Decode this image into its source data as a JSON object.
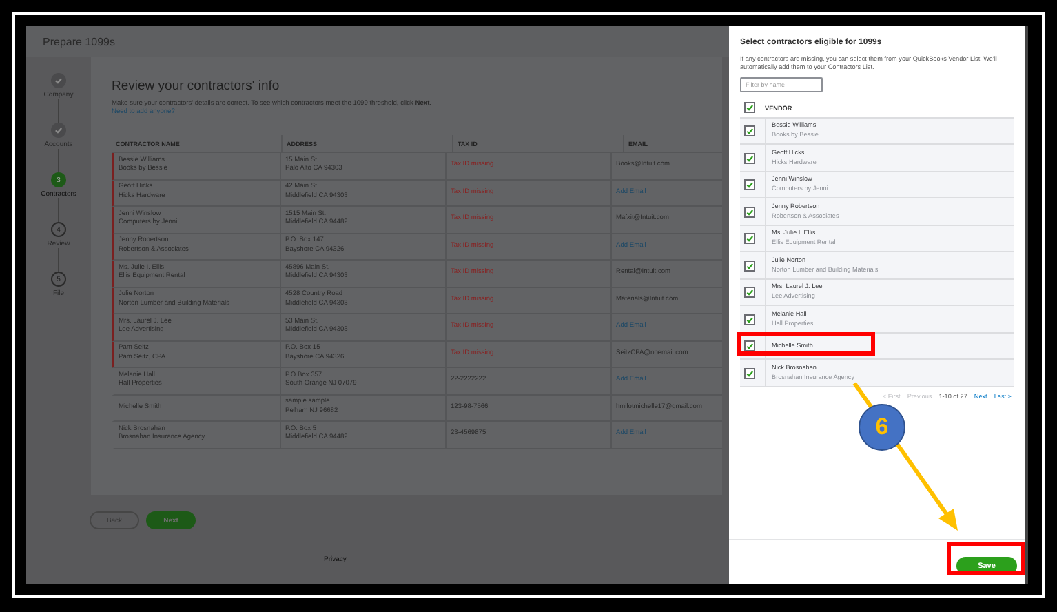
{
  "page": {
    "title": "Prepare 1099s",
    "steps": [
      {
        "label": "Company",
        "done": true,
        "selected": false
      },
      {
        "label": "Accounts",
        "done": true,
        "selected": false
      },
      {
        "label": "Contractors",
        "number": "3",
        "done": false,
        "selected": true
      },
      {
        "label": "Review",
        "number": "4",
        "done": false,
        "selected": false
      },
      {
        "label": "File",
        "number": "5",
        "done": false,
        "selected": false
      }
    ],
    "heading": "Review your contractors' info",
    "description": "Make sure your contractors' details are correct. To see which contractors meet the 1099 threshold, click **Next**.",
    "add_link": "Need to add anyone?",
    "table": {
      "columns": [
        "CONTRACTOR NAME",
        "ADDRESS",
        "TAX ID",
        "EMAIL"
      ],
      "rows": [
        {
          "name": "Bessie Williams",
          "company": "Books by Bessie",
          "address_1": "15 Main St.",
          "address_2": "Palo Alto CA 94303",
          "tax_id": "Tax ID missing",
          "tax_id_missing": true,
          "email": "Books@Intuit.com",
          "email_is_link": false
        },
        {
          "name": "Geoff Hicks",
          "company": "Hicks Hardware",
          "address_1": "42 Main St.",
          "address_2": "Middlefield CA 94303",
          "tax_id": "Tax ID missing",
          "tax_id_missing": true,
          "email": "Add Email",
          "email_is_link": true
        },
        {
          "name": "Jenni Winslow",
          "company": "Computers by Jenni",
          "address_1": "1515 Main St.",
          "address_2": "Middlefield CA 94482",
          "tax_id": "Tax ID missing",
          "tax_id_missing": true,
          "email": "Mafxit@Intuit.com",
          "email_is_link": false
        },
        {
          "name": "Jenny Robertson",
          "company": "Robertson & Associates",
          "address_1": "P.O. Box 147",
          "address_2": "Bayshore CA 94326",
          "tax_id": "Tax ID missing",
          "tax_id_missing": true,
          "email": "Add Email",
          "email_is_link": true
        },
        {
          "name": "Ms. Julie I. Ellis",
          "company": "Ellis Equipment Rental",
          "address_1": "45896 Main St.",
          "address_2": "Middlefield CA 94303",
          "tax_id": "Tax ID missing",
          "tax_id_missing": true,
          "email": "Rental@Intuit.com",
          "email_is_link": false
        },
        {
          "name": "Julie Norton",
          "company": "Norton Lumber and Building Materials",
          "address_1": "4528 Country Road",
          "address_2": "Middlefield CA 94303",
          "tax_id": "Tax ID missing",
          "tax_id_missing": true,
          "email": "Materials@Intuit.com",
          "email_is_link": false
        },
        {
          "name": "Mrs. Laurel J. Lee",
          "company": "Lee Advertising",
          "address_1": "53 Main St.",
          "address_2": "Middlefield CA 94303",
          "tax_id": "Tax ID missing",
          "tax_id_missing": true,
          "email": "Add Email",
          "email_is_link": true
        },
        {
          "name": "Pam Seitz",
          "company": "Pam Seitz, CPA",
          "address_1": "P.O. Box 15",
          "address_2": "Bayshore CA 94326",
          "tax_id": "Tax ID missing",
          "tax_id_missing": true,
          "email": "SeitzCPA@noemail.com",
          "email_is_link": false
        },
        {
          "name": "Melanie Hall",
          "company": "Hall Properties",
          "address_1": "P.O.Box 357",
          "address_2": "South Orange NJ 07079",
          "tax_id": "22-2222222",
          "tax_id_missing": false,
          "email": "Add Email",
          "email_is_link": true
        },
        {
          "name": "Michelle Smith",
          "address_1": "sample sample",
          "address_2": "Pelham NJ 96682",
          "tax_id": "123-98-7566",
          "tax_id_missing": false,
          "email": "hmilotmichelle17@gmail.com",
          "email_is_link": false
        },
        {
          "name": "Nick Brosnahan",
          "company": "Brosnahan Insurance Agency",
          "address_1": "P.O. Box 5",
          "address_2": "Middlefield CA 94482",
          "tax_id": "23-4569875",
          "tax_id_missing": false,
          "email": "Add Email",
          "email_is_link": true
        }
      ]
    },
    "back_button": "Back",
    "next_button": "Next",
    "footer_link": "Privacy"
  },
  "panel": {
    "title": "Select contractors eligible for 1099s",
    "description": "If any contractors are missing, you can select them from your QuickBooks Vendor List. We'll automatically add them to your Contractors List.",
    "filter": {
      "placeholder": "Filter by name"
    },
    "header": {
      "label": "VENDOR",
      "checked": true
    },
    "rows": [
      {
        "name": "Bessie Williams",
        "company": "Books by Bessie",
        "checked": true,
        "highlighted": false
      },
      {
        "name": "Geoff Hicks",
        "company": "Hicks Hardware",
        "checked": true,
        "highlighted": false
      },
      {
        "name": "Jenni Winslow",
        "company": "Computers by Jenni",
        "checked": true,
        "highlighted": false
      },
      {
        "name": "Jenny Robertson",
        "company": "Robertson & Associates",
        "checked": true,
        "highlighted": false
      },
      {
        "name": "Ms. Julie I. Ellis",
        "company": "Ellis Equipment Rental",
        "checked": true,
        "highlighted": false
      },
      {
        "name": "Julie Norton",
        "company": "Norton Lumber and Building Materials",
        "checked": true,
        "highlighted": false
      },
      {
        "name": "Mrs. Laurel J. Lee",
        "company": "Lee Advertising",
        "checked": true,
        "highlighted": false
      },
      {
        "name": "Melanie Hall",
        "company": "Hall Properties",
        "checked": true,
        "highlighted": false
      },
      {
        "name": "Michelle Smith",
        "checked": true,
        "highlighted": true
      },
      {
        "name": "Nick Brosnahan",
        "company": "Brosnahan Insurance Agency",
        "checked": true,
        "highlighted": false
      }
    ],
    "pagination": {
      "first": "< First",
      "previous": "Previous",
      "range": "1-10 of 27",
      "next": "Next",
      "last": "Last >"
    },
    "save_button": "Save",
    "save_highlighted": true
  },
  "annotation": {
    "step": "6"
  }
}
